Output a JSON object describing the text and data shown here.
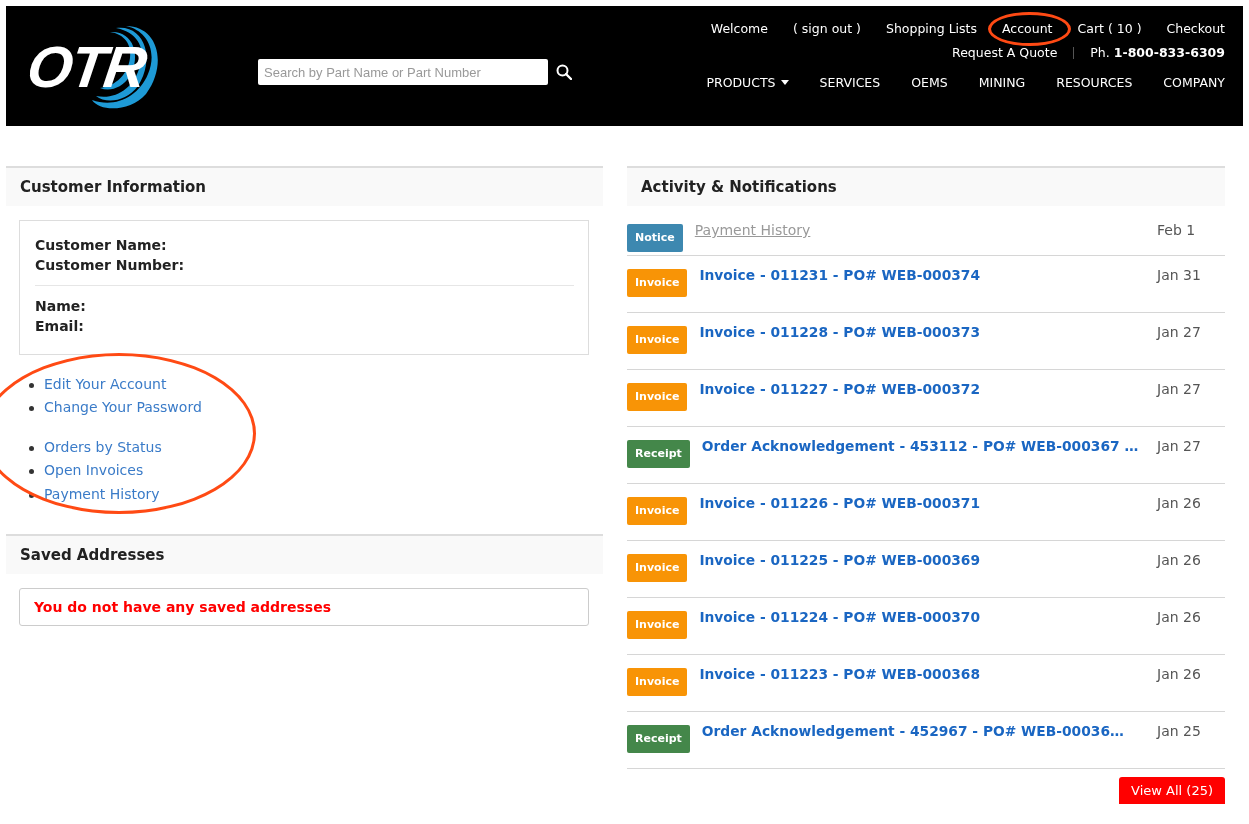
{
  "logo": {
    "text": "OTR"
  },
  "search": {
    "placeholder": "Search by Part Name or Part Number"
  },
  "top_links": [
    {
      "label": "Welcome",
      "circled": false
    },
    {
      "label": "( sign out )",
      "circled": false
    },
    {
      "label": "Shopping Lists",
      "circled": false
    },
    {
      "label": "Account",
      "circled": true
    },
    {
      "label": "Cart ( 10 )",
      "circled": false
    },
    {
      "label": "Checkout",
      "circled": false
    }
  ],
  "quote_link": "Request A Quote",
  "phone": "Ph. **1-800-833-6309**",
  "nav": [
    {
      "label": "PRODUCTS",
      "dropdown": true
    },
    {
      "label": "SERVICES",
      "dropdown": false
    },
    {
      "label": "OEMS",
      "dropdown": false
    },
    {
      "label": "MINING",
      "dropdown": false
    },
    {
      "label": "RESOURCES",
      "dropdown": false
    },
    {
      "label": "COMPANY",
      "dropdown": false
    }
  ],
  "customer_info": {
    "title": "Customer Information",
    "field_groups": [
      [
        "Customer Name:",
        "Customer Number:"
      ],
      [
        "Name:",
        "Email:"
      ]
    ],
    "link_groups": [
      [
        "Edit Your Account",
        "Change Your Password"
      ],
      [
        "Orders by Status",
        "Open Invoices",
        "Payment History"
      ]
    ],
    "links_circled": true
  },
  "saved_addresses": {
    "title": "Saved Addresses",
    "message": "You do not have any saved addresses"
  },
  "activity": {
    "title": "Activity & Notifications",
    "items": [
      {
        "kind": "notice",
        "badge": "Notice",
        "title": "Payment History",
        "date": "Feb 1"
      },
      {
        "kind": "invoice",
        "badge": "Invoice",
        "title": "Invoice - 011231 - PO# WEB-000374",
        "date": "Jan 31"
      },
      {
        "kind": "invoice",
        "badge": "Invoice",
        "title": "Invoice - 011228 - PO# WEB-000373",
        "date": "Jan 27"
      },
      {
        "kind": "invoice",
        "badge": "Invoice",
        "title": "Invoice - 011227 - PO# WEB-000372",
        "date": "Jan 27"
      },
      {
        "kind": "receipt",
        "badge": "Receipt",
        "title": "Order Acknowledgement - 453112 - PO# WEB-000367 …",
        "date": "Jan 27"
      },
      {
        "kind": "invoice",
        "badge": "Invoice",
        "title": "Invoice - 011226 - PO# WEB-000371",
        "date": "Jan 26"
      },
      {
        "kind": "invoice",
        "badge": "Invoice",
        "title": "Invoice - 011225 - PO# WEB-000369",
        "date": "Jan 26"
      },
      {
        "kind": "invoice",
        "badge": "Invoice",
        "title": "Invoice - 011224 - PO# WEB-000370",
        "date": "Jan 26"
      },
      {
        "kind": "invoice",
        "badge": "Invoice",
        "title": "Invoice - 011223 - PO# WEB-000368",
        "date": "Jan 26"
      },
      {
        "kind": "receipt",
        "badge": "Receipt",
        "title": "Order Acknowledgement - 452967 - PO# WEB-00036…",
        "date": "Jan 25"
      }
    ],
    "view_all": "View All (25)"
  }
}
